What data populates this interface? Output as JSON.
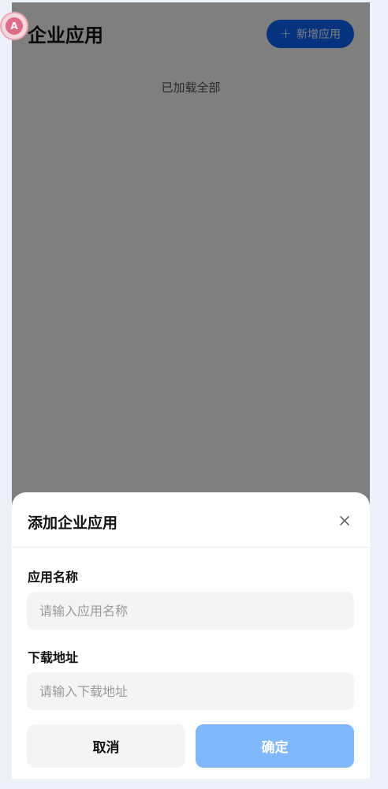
{
  "page": {
    "title": "企业应用",
    "add_button_label": "新增应用",
    "loaded_text": "已加载全部",
    "avatar_text": "A"
  },
  "dialog": {
    "title": "添加企业应用",
    "name_label": "应用名称",
    "name_placeholder": "请输入应用名称",
    "url_label": "下载地址",
    "url_placeholder": "请输入下载地址",
    "cancel_label": "取消",
    "confirm_label": "确定"
  },
  "colors": {
    "accent": "#0a66ff",
    "confirm_disabled": "#80b8fb",
    "overlay": "rgba(0,0,0,0.5)"
  }
}
